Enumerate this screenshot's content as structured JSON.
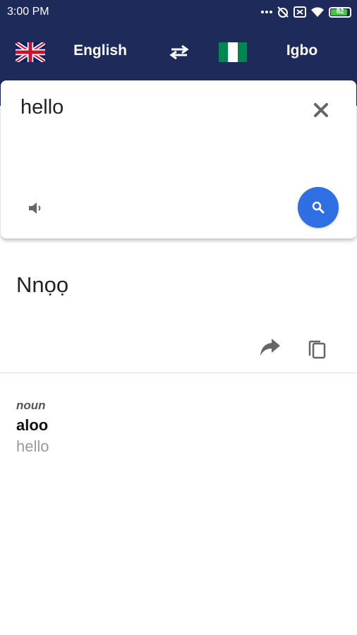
{
  "status_bar": {
    "time": "3:00 PM",
    "battery_level": "82",
    "icons": [
      "dots-icon",
      "alarm-off-icon",
      "sim-icon",
      "wifi-icon",
      "battery-icon"
    ]
  },
  "language_bar": {
    "source_language": "English",
    "target_language": "Igbo",
    "source_flag": "uk-flag-icon",
    "target_flag": "nigeria-flag-icon",
    "swap_icon": "swap-arrows-icon"
  },
  "input": {
    "text": "hello",
    "icons": [
      "close-icon",
      "speaker-icon",
      "search-icon"
    ]
  },
  "output": {
    "translation": "Nnọọ",
    "icons": [
      "share-icon",
      "copy-icon"
    ]
  },
  "dictionary": {
    "part_of_speech": "noun",
    "word": "aloo",
    "translation": "hello"
  },
  "colors": {
    "header": "#1e2a5a",
    "accent": "#2f6fe4",
    "battery": "#3ecb3a",
    "nigeria_green": "#008751"
  }
}
